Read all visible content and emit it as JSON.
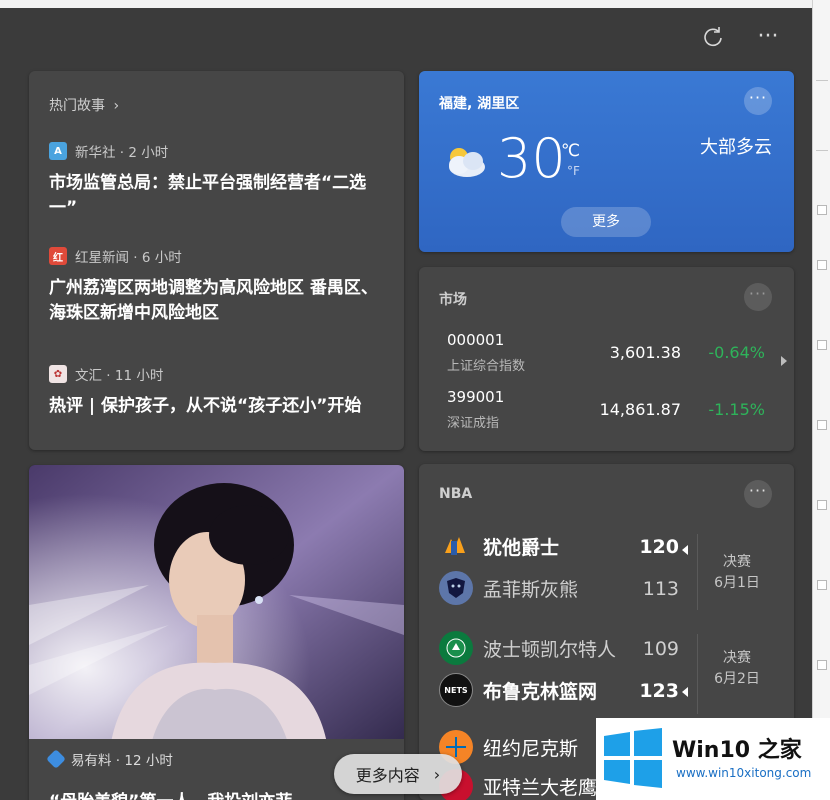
{
  "header": {
    "refresh_icon": "refresh-icon",
    "more_label": "···"
  },
  "top_stories": {
    "title": "热门故事",
    "items": [
      {
        "source": "新华社 · 2 小时",
        "headline": "市场监管总局：禁止平台强制经营者“二选一”",
        "icon": "xinhua-logo",
        "color": "#4aa3df"
      },
      {
        "source": "红星新闻 · 6 小时",
        "headline": "广州荔湾区两地调整为高风险地区 番禺区、海珠区新增中风险地区",
        "icon": "hongxing-logo",
        "color": "#e04a3a"
      },
      {
        "source": "文汇 · 11 小时",
        "headline": "热评 | 保护孩子，从不说“孩子还小”开始",
        "icon": "wenhui-logo",
        "color": "#f0e4e4"
      }
    ]
  },
  "weather": {
    "location": "福建, 湖里区",
    "temp": "30",
    "unit_c": "℃",
    "unit_f": "°F",
    "condition": "大部多云",
    "more": "更多",
    "icon": "partly-cloudy-icon"
  },
  "market": {
    "title": "市场",
    "rows": [
      {
        "code": "000001",
        "name": "上证综合指数",
        "value": "3,601.38",
        "change": "-0.64%"
      },
      {
        "code": "399001",
        "name": "深证成指",
        "value": "14,861.87",
        "change": "-1.15%"
      }
    ]
  },
  "nba": {
    "title": "NBA",
    "games": [
      {
        "home": "犹他爵士",
        "home_score": "120",
        "away": "孟菲斯灰熊",
        "away_score": "113",
        "stage": "决赛",
        "date": "6月1日"
      },
      {
        "home": "波士顿凯尔特人",
        "home_score": "109",
        "away": "布鲁克林篮网",
        "away_score": "123",
        "stage": "决赛",
        "date": "6月2日"
      }
    ],
    "partial": [
      "纽约尼克斯",
      "亚特兰大老鹰"
    ]
  },
  "photo_story": {
    "source": "易有料 · 12 小时",
    "headline": "“母胎美貌”第一人，我投刘亦菲"
  },
  "more_content": "更多内容",
  "watermark": {
    "brand": "Win10 之家",
    "url": "www.win10xitong.com"
  },
  "colors": {
    "accent": "#2f6bc6",
    "positive": "#2eb35a",
    "card": "#464646",
    "bg": "#3b3b3b"
  }
}
